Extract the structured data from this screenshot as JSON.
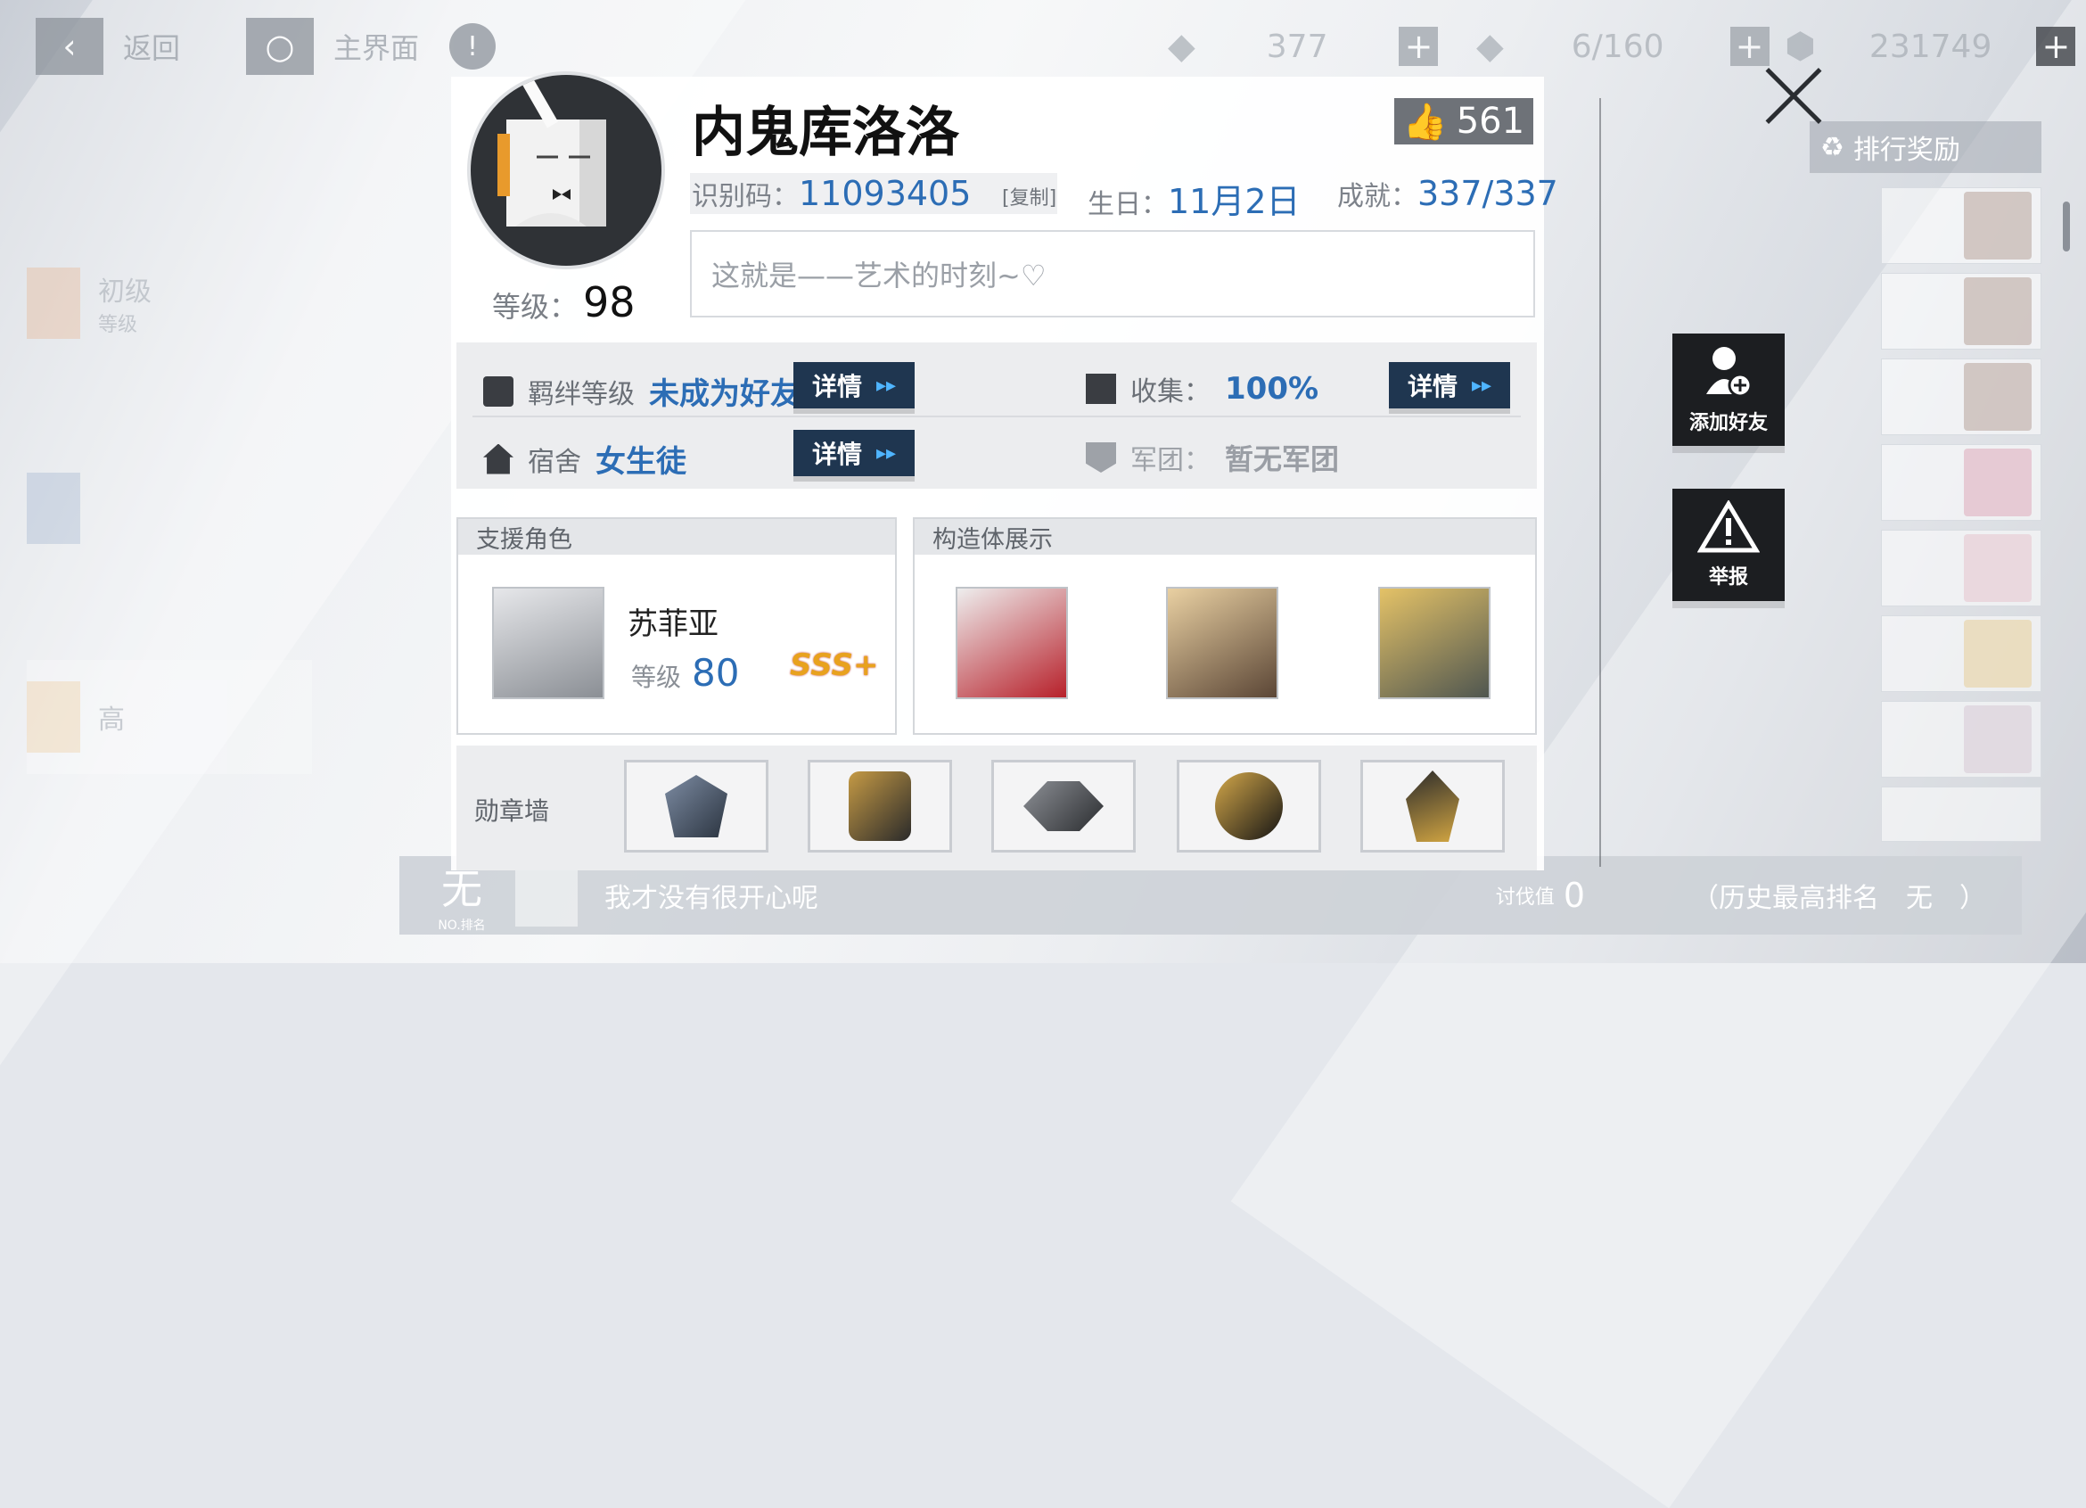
{
  "topbar": {
    "back_label": "返回",
    "home_label": "主界面",
    "res1": "377",
    "res2": "6/160",
    "res3": "231749"
  },
  "left_list": [
    {
      "title": "初级",
      "sub": "等级"
    },
    {
      "title": "",
      "sub": ""
    },
    {
      "title": "高",
      "sub": ""
    }
  ],
  "rank_reward_label": "排行奖励",
  "profile": {
    "name": "内鬼库洛洛",
    "likes": "561",
    "id_label": "识别码：",
    "id_value": "11093405",
    "copy_label": "[复制]",
    "birthday_label": "生日：",
    "birthday_value": "11月2日",
    "achievement_label": "成就：",
    "achievement_value": "337/337",
    "level_label": "等级：",
    "level_value": "98",
    "signature": "这就是——艺术的时刻~♡"
  },
  "stats": {
    "bond_label": "羁绊等级",
    "bond_value": "未成为好友",
    "collect_label": "收集：",
    "collect_value": "100%",
    "dorm_label": "宿舍",
    "dorm_value": "女生徒",
    "legion_label": "军团：",
    "legion_value": "暂无军团",
    "detail_label": "详情",
    "detail_arrow": "▸▸"
  },
  "support": {
    "header": "支援角色",
    "name": "苏菲亚",
    "level_label": "等级",
    "level_value": "80",
    "rank": "SSS+"
  },
  "construct": {
    "header": "构造体展示"
  },
  "medals": {
    "label": "勋章墙"
  },
  "side_buttons": {
    "add_friend": "添加好友",
    "report": "举报"
  },
  "bottom": {
    "rank_glyph": "无",
    "rank_no": "NO.排名",
    "quote": "我才没有很开心呢",
    "score_label": "讨伐值",
    "score_value": "0",
    "best_rank": "（历史最高排名　无　）"
  },
  "colors": {
    "accent_blue": "#2c6db5",
    "detail_button": "#1f3650",
    "dark_button": "#1c1e21"
  }
}
